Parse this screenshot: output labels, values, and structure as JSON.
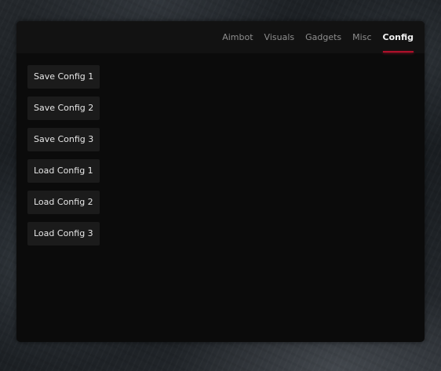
{
  "tabs": [
    {
      "label": "Aimbot",
      "active": false
    },
    {
      "label": "Visuals",
      "active": false
    },
    {
      "label": "Gadgets",
      "active": false
    },
    {
      "label": "Misc",
      "active": false
    },
    {
      "label": "Config",
      "active": true
    }
  ],
  "config_buttons": [
    "Save Config 1",
    "Save Config 2",
    "Save Config 3",
    "Load Config 1",
    "Load Config 2",
    "Load Config 3"
  ],
  "colors": {
    "accent": "#b0102a",
    "panel": "#0b0b0b",
    "header": "#121212",
    "button": "#1b1b1b"
  }
}
